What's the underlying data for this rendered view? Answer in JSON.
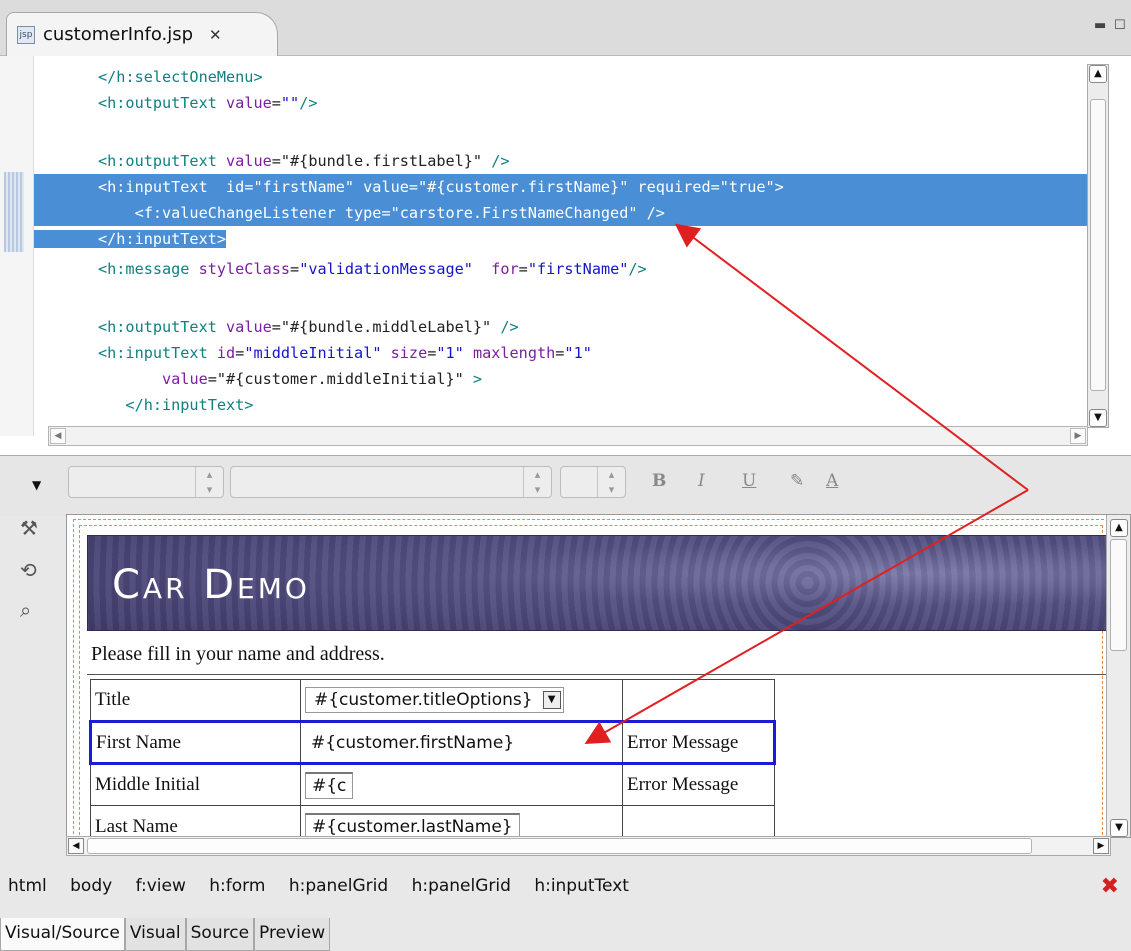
{
  "editor_tab": {
    "title": "customerInfo.jsp",
    "close": "✕"
  },
  "code_lines": [
    "</h:selectOneMenu>",
    "<h:outputText value=\"\"/>",
    "",
    "<h:outputText value=\"#{bundle.firstLabel}\" />",
    "<h:inputText  id=\"firstName\" value=\"#{customer.firstName}\" required=\"true\">",
    "    <f:valueChangeListener type=\"carstore.FirstNameChanged\" />",
    "</h:inputText>",
    "<h:message styleClass=\"validationMessage\"  for=\"firstName\"/>",
    "",
    "<h:outputText value=\"#{bundle.middleLabel}\" />",
    "<h:inputText id=\"middleInitial\" size=\"1\" maxlength=\"1\"",
    "       value=\"#{customer.middleInitial}\" >",
    "   </h:inputText>"
  ],
  "format_toolbar": {
    "bold": "B",
    "italic": "I",
    "underline": "U"
  },
  "visual": {
    "banner_title": "Car Demo",
    "intro": "Please fill in your name and address.",
    "rows": [
      {
        "label": "Title",
        "field": "#{customer.titleOptions}",
        "message": ""
      },
      {
        "label": "First Name",
        "field": "#{customer.firstName}",
        "message": "Error Message"
      },
      {
        "label": "Middle Initial",
        "field": "#{c",
        "message": "Error Message"
      },
      {
        "label": "Last Name",
        "field": "#{customer.lastName}",
        "message": ""
      }
    ]
  },
  "breadcrumb": [
    "html",
    "body",
    "f:view",
    "h:form",
    "h:panelGrid",
    "h:panelGrid",
    "h:inputText"
  ],
  "bottom_tabs": [
    "Visual/Source",
    "Visual",
    "Source",
    "Preview"
  ],
  "colors": {
    "selection": "#4a8ed6",
    "highlight_border": "#1b1bd8",
    "annotation_arrow": "#e02020"
  }
}
